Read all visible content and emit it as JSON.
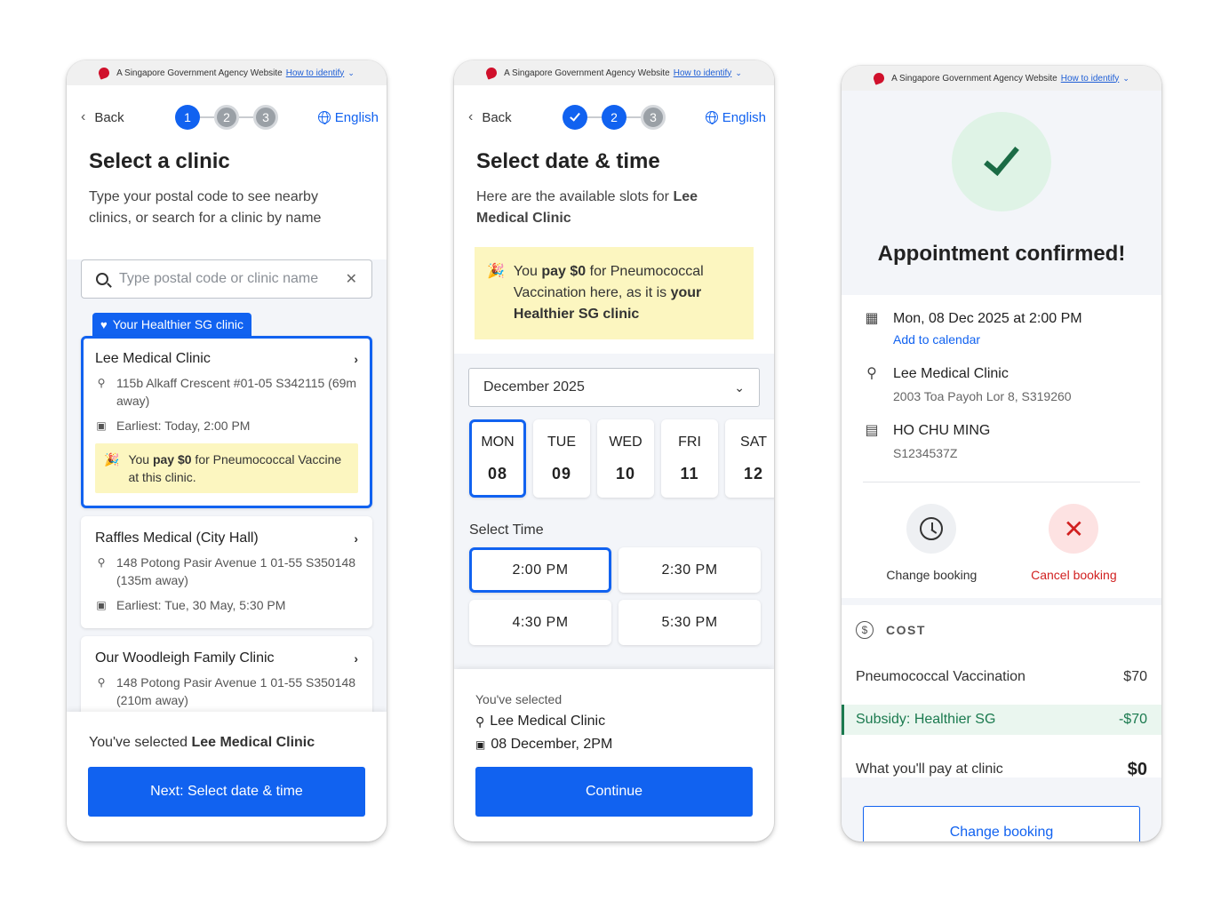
{
  "masthead": {
    "text": "A Singapore Government Agency Website",
    "link": "How to identify"
  },
  "nav": {
    "back": "Back",
    "language": "English"
  },
  "screen1": {
    "steps": [
      "1",
      "2",
      "3"
    ],
    "title": "Select a clinic",
    "subtitle": "Type your postal code to see nearby clinics, or search for a clinic by name",
    "search_placeholder": "Type postal code or clinic name",
    "hsg_tag": "Your Healthier SG clinic",
    "clinics": [
      {
        "name": "Lee Medical Clinic",
        "address": "115b Alkaff Crescent #01-05 S342115 (69m away)",
        "earliest": "Earliest: Today, 2:00 PM",
        "promo_pre": "You ",
        "promo_bold": "pay $0",
        "promo_post": " for Pneumococcal Vaccine at this clinic."
      },
      {
        "name": "Raffles Medical (City Hall)",
        "address": "148 Potong Pasir Avenue 1 01-55 S350148 (135m away)",
        "earliest": "Earliest: Tue, 30 May, 5:30 PM"
      },
      {
        "name": "Our Woodleigh Family Clinic",
        "address": "148 Potong Pasir Avenue 1 01-55 S350148 (210m away)"
      }
    ],
    "selected_pre": "You've selected ",
    "selected_name": "Lee Medical Clinic",
    "next_button": "Next: Select date & time"
  },
  "screen2": {
    "steps": [
      "2",
      "3"
    ],
    "title": "Select date & time",
    "subtitle_pre": "Here are the available slots for ",
    "subtitle_bold": "Lee Medical Clinic",
    "promo_pre": "You ",
    "promo_bold1": "pay $0",
    "promo_mid": " for Pneumococcal Vaccination here, as it is ",
    "promo_bold2": "your Healthier SG clinic",
    "month": "December 2025",
    "days": [
      {
        "dow": "MON",
        "num": "08"
      },
      {
        "dow": "TUE",
        "num": "09"
      },
      {
        "dow": "WED",
        "num": "10"
      },
      {
        "dow": "FRI",
        "num": "11"
      },
      {
        "dow": "SAT",
        "num": "12"
      }
    ],
    "select_time_label": "Select Time",
    "times": [
      "2:00 PM",
      "2:30 PM",
      "4:30 PM",
      "5:30 PM"
    ],
    "youve_selected": "You've selected",
    "sel_clinic": "Lee Medical Clinic",
    "sel_date": "08 December, 2PM",
    "continue_button": "Continue"
  },
  "screen3": {
    "title": "Appointment confirmed!",
    "datetime": "Mon, 08 Dec 2025 at 2:00 PM",
    "add_calendar": "Add to calendar",
    "clinic": "Lee Medical Clinic",
    "clinic_address": "2003 Toa Payoh Lor 8, S319260",
    "patient": "HO CHU MING",
    "patient_id": "S1234537Z",
    "change_booking": "Change booking",
    "cancel_booking": "Cancel booking",
    "cost_label": "COST",
    "cost_items": [
      {
        "label": "Pneumococcal Vaccination",
        "amount": "$70"
      },
      {
        "label": "Subsidy: Healthier SG",
        "amount": "-$70"
      }
    ],
    "pay_label": "What you'll pay at clinic",
    "pay_amount": "$0",
    "change_button": "Change booking"
  },
  "colors": {
    "primary": "#1162f0",
    "promo_bg": "#fcf6c0",
    "success": "#1b6b45",
    "danger": "#d11f1f"
  }
}
